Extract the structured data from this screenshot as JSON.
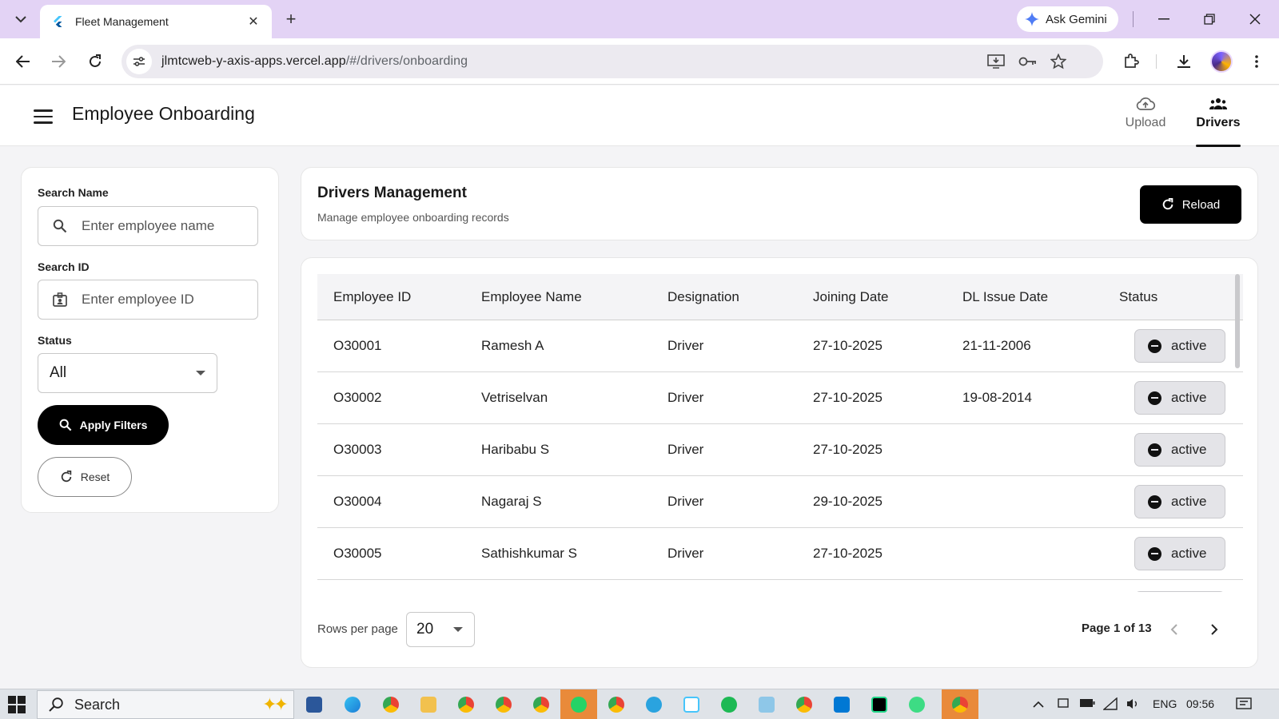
{
  "browser": {
    "tab_title": "Fleet Management",
    "new_tab_symbol": "+",
    "close_symbol": "✕",
    "gemini_label": "Ask Gemini",
    "url_host": "jlmtcweb-y-axis-apps.vercel.app",
    "url_path": "/#/drivers/onboarding"
  },
  "header": {
    "title": "Employee Onboarding",
    "tabs": [
      {
        "label": "Upload",
        "icon": "cloud-upload-icon",
        "active": false
      },
      {
        "label": "Drivers",
        "icon": "people-icon",
        "active": true
      }
    ]
  },
  "filters": {
    "search_name_label": "Search Name",
    "search_name_placeholder": "Enter employee name",
    "search_id_label": "Search ID",
    "search_id_placeholder": "Enter employee ID",
    "status_label": "Status",
    "status_value": "All",
    "apply_label": "Apply Filters",
    "reset_label": "Reset"
  },
  "panel": {
    "title": "Drivers Management",
    "subtitle": "Manage employee onboarding records",
    "reload_label": "Reload"
  },
  "table": {
    "columns": [
      "Employee ID",
      "Employee Name",
      "Designation",
      "Joining Date",
      "DL Issue Date",
      "Status"
    ],
    "rows": [
      {
        "id": "O30001",
        "name": "Ramesh A",
        "designation": "Driver",
        "joining": "27-10-2025",
        "dl_issue": "21-11-2006",
        "status": "active"
      },
      {
        "id": "O30002",
        "name": "Vetriselvan",
        "designation": "Driver",
        "joining": "27-10-2025",
        "dl_issue": "19-08-2014",
        "status": "active"
      },
      {
        "id": "O30003",
        "name": "Haribabu S",
        "designation": "Driver",
        "joining": "27-10-2025",
        "dl_issue": "",
        "status": "active"
      },
      {
        "id": "O30004",
        "name": "Nagaraj S",
        "designation": "Driver",
        "joining": "29-10-2025",
        "dl_issue": "",
        "status": "active"
      },
      {
        "id": "O30005",
        "name": "Sathishkumar S",
        "designation": "Driver",
        "joining": "27-10-2025",
        "dl_issue": "",
        "status": "active"
      }
    ]
  },
  "pagination": {
    "rows_per_page_label": "Rows per page",
    "rows_per_page_value": "20",
    "page_info": "Page 1 of 13"
  },
  "taskbar": {
    "search_label": "Search",
    "language": "ENG",
    "time": "09:56",
    "apps": [
      "word-icon",
      "edge-icon",
      "chrome-icon",
      "file-explorer-icon",
      "chrome-icon",
      "chrome-icon",
      "chrome-icon",
      "whatsapp-icon",
      "chrome-icon",
      "telegram-icon",
      "flutter-icon",
      "spotify-icon",
      "notepad-icon",
      "chrome-icon",
      "vscode-icon",
      "webstorm-icon",
      "android-studio-icon",
      "chrome-icon"
    ]
  },
  "colors": {
    "tabbar": "#e3d3f5",
    "primary_button": "#000000",
    "chip_bg": "#e4e4e8",
    "page_bg": "#f4f4f6"
  }
}
